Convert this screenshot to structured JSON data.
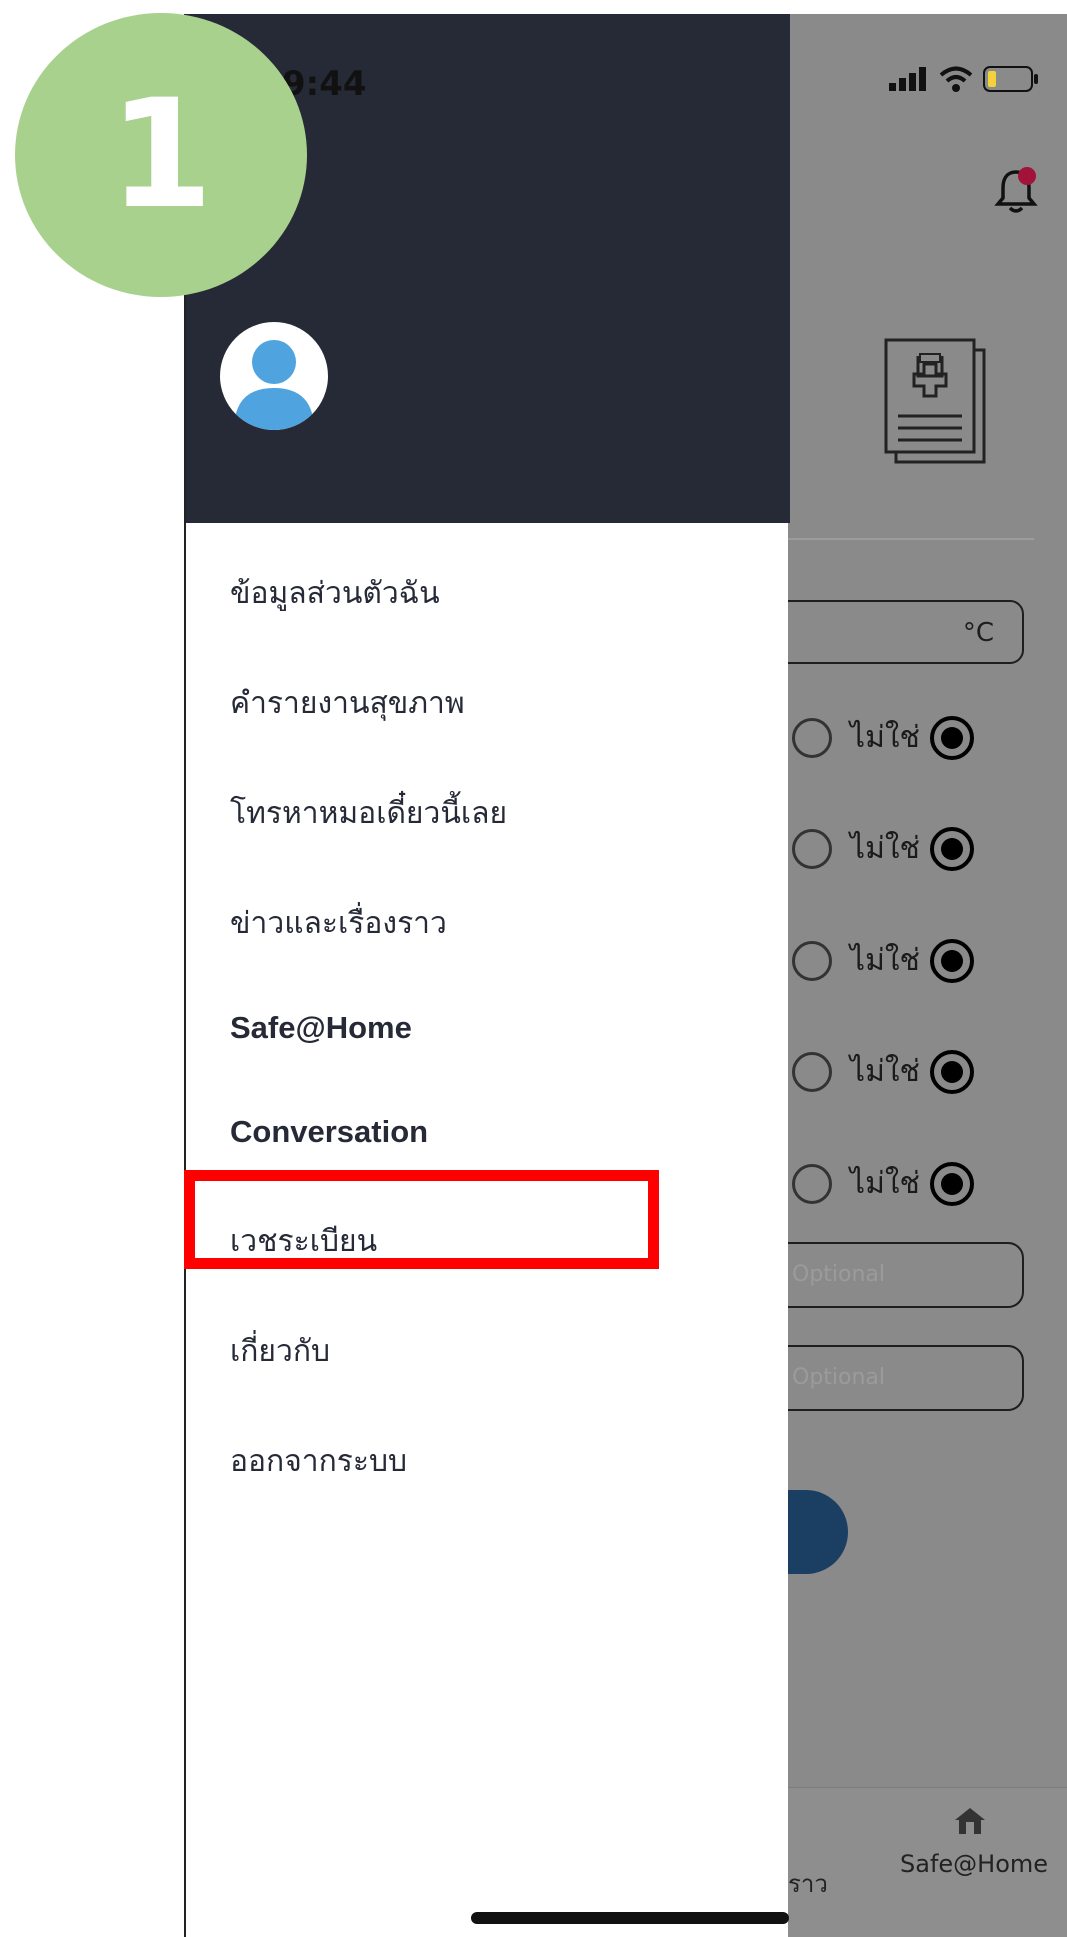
{
  "status_bar": {
    "time": "9:44"
  },
  "step_badge": {
    "number": "1"
  },
  "drawer": {
    "menu_items": [
      "ข้อมูลส่วนตัวฉัน",
      "คำรายงานสุขภาพ",
      "โทรหาหมอเดี๋ยวนี้เลย",
      "ข่าวและเรื่องราว",
      "Safe@Home",
      "Conversation",
      "เวชระเบียน",
      "เกี่ยวกับ",
      "ออกจากระบบ"
    ]
  },
  "background": {
    "temperature_unit": "°C",
    "radio_no_label": "ไม่ใช่",
    "optional_placeholder": "Optional",
    "tab_partial_label": "ราว",
    "tab_safe_home_label": "Safe@Home"
  },
  "colors": {
    "drawer_header": "#262a37",
    "highlight": "#ff0000",
    "badge": "#a9d18e",
    "notification_dot": "#a3123a"
  }
}
